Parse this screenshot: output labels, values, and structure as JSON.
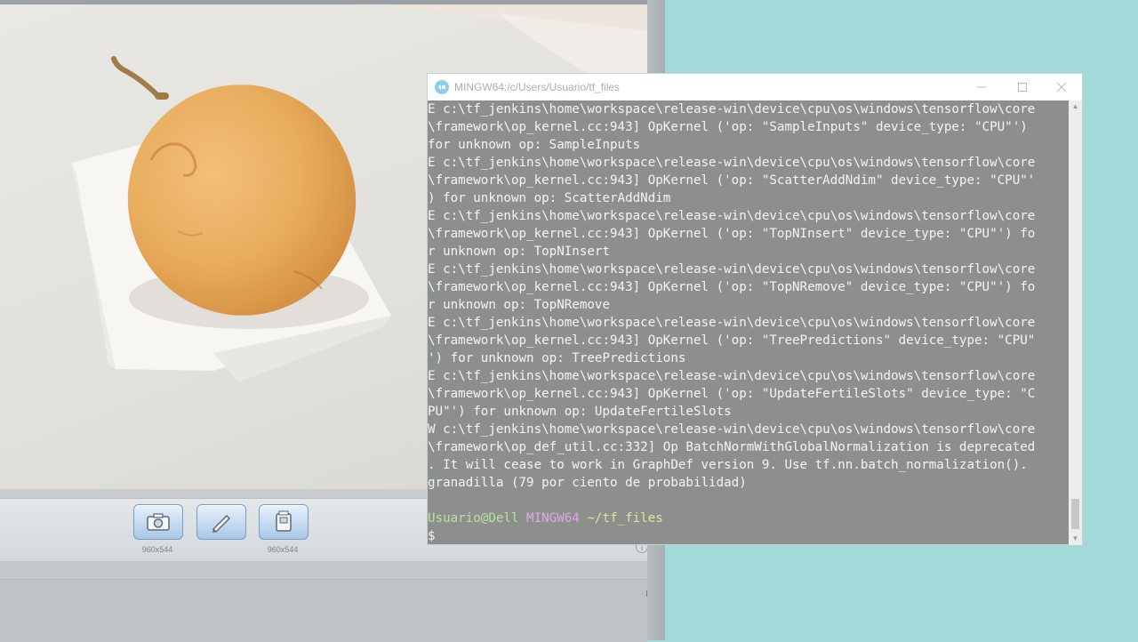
{
  "camera": {
    "tools": [
      {
        "name": "camera",
        "label": "960x544"
      },
      {
        "name": "pen",
        "label": ""
      },
      {
        "name": "video",
        "label": "960x544"
      }
    ]
  },
  "terminal": {
    "title": "MINGW64:/c/Users/Usuario/tf_files",
    "lines": [
      "E c:\\tf_jenkins\\home\\workspace\\release-win\\device\\cpu\\os\\windows\\tensorflow\\core",
      "\\framework\\op_kernel.cc:943] OpKernel ('op: \"SampleInputs\" device_type: \"CPU\"')",
      "for unknown op: SampleInputs",
      "E c:\\tf_jenkins\\home\\workspace\\release-win\\device\\cpu\\os\\windows\\tensorflow\\core",
      "\\framework\\op_kernel.cc:943] OpKernel ('op: \"ScatterAddNdim\" device_type: \"CPU\"'",
      ") for unknown op: ScatterAddNdim",
      "E c:\\tf_jenkins\\home\\workspace\\release-win\\device\\cpu\\os\\windows\\tensorflow\\core",
      "\\framework\\op_kernel.cc:943] OpKernel ('op: \"TopNInsert\" device_type: \"CPU\"') fo",
      "r unknown op: TopNInsert",
      "E c:\\tf_jenkins\\home\\workspace\\release-win\\device\\cpu\\os\\windows\\tensorflow\\core",
      "\\framework\\op_kernel.cc:943] OpKernel ('op: \"TopNRemove\" device_type: \"CPU\"') fo",
      "r unknown op: TopNRemove",
      "E c:\\tf_jenkins\\home\\workspace\\release-win\\device\\cpu\\os\\windows\\tensorflow\\core",
      "\\framework\\op_kernel.cc:943] OpKernel ('op: \"TreePredictions\" device_type: \"CPU\"",
      "') for unknown op: TreePredictions",
      "E c:\\tf_jenkins\\home\\workspace\\release-win\\device\\cpu\\os\\windows\\tensorflow\\core",
      "\\framework\\op_kernel.cc:943] OpKernel ('op: \"UpdateFertileSlots\" device_type: \"C",
      "PU\"') for unknown op: UpdateFertileSlots",
      "W c:\\tf_jenkins\\home\\workspace\\release-win\\device\\cpu\\os\\windows\\tensorflow\\core",
      "\\framework\\op_def_util.cc:332] Op BatchNormWithGlobalNormalization is deprecated",
      ". It will cease to work in GraphDef version 9. Use tf.nn.batch_normalization().",
      "granadilla (79 por ciento de probabilidad)",
      ""
    ],
    "prompt": {
      "user": "Usuario@Dell",
      "system": "MINGW64",
      "dir": "~/tf_files",
      "symbol": "$"
    }
  }
}
